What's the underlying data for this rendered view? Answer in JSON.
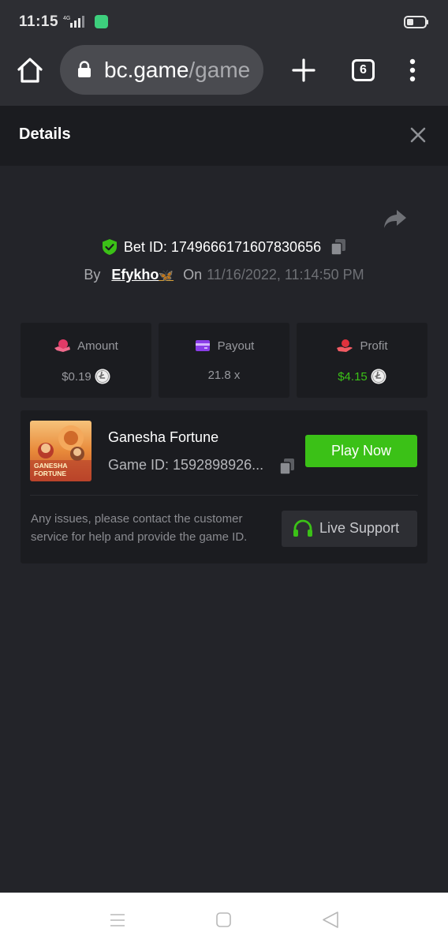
{
  "status_bar": {
    "time": "11:15",
    "network": "4G"
  },
  "browser": {
    "url_domain": "bc.game",
    "url_path": "/game",
    "tab_count": "6"
  },
  "header": {
    "title": "Details"
  },
  "bet": {
    "id_label": "Bet ID: 1749666171607830656",
    "by_label": "By",
    "username": "Efykho",
    "user_emoji": "🦋",
    "on_label": "On",
    "date": "11/16/2022, 11:14:50 PM"
  },
  "stats": [
    {
      "label": "Amount",
      "value": "$0.19",
      "icon": "amount-icon"
    },
    {
      "label": "Payout",
      "value": "21.8 x",
      "icon": "payout-icon"
    },
    {
      "label": "Profit",
      "value": "$4.15",
      "icon": "profit-icon"
    }
  ],
  "game": {
    "name": "Ganesha Fortune",
    "id_label": "Game ID: 1592898926...",
    "thumb_text_line1": "GANESHA",
    "thumb_text_line2": "FORTUNE",
    "play_label": "Play Now",
    "support_text": "Any issues, please contact the customer service for help and provide the game ID.",
    "live_support_label": "Live Support"
  },
  "colors": {
    "accent_green": "#3bc117",
    "background": "#232429",
    "card": "#1b1c20"
  }
}
